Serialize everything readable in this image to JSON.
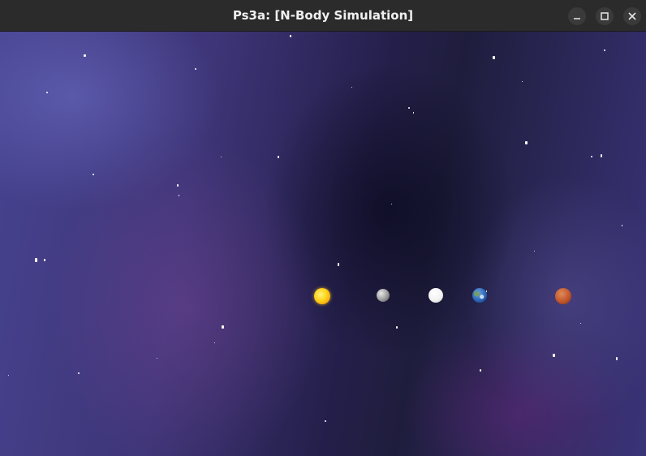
{
  "window": {
    "title": "Ps3a: [N-Body Simulation]",
    "buttons": {
      "minimize": "minimize-icon",
      "maximize": "maximize-icon",
      "close": "close-icon"
    }
  },
  "simulation": {
    "bodies": [
      {
        "name": "sun",
        "icon": "sun-icon",
        "color": "#ffd21a"
      },
      {
        "name": "mercury",
        "icon": "mercury-icon",
        "color": "#9a9a9a"
      },
      {
        "name": "venus",
        "icon": "venus-icon",
        "color": "#f2f2f2"
      },
      {
        "name": "earth",
        "icon": "earth-icon",
        "color": "#2b66b8"
      },
      {
        "name": "mars",
        "icon": "mars-icon",
        "color": "#c2562b"
      }
    ],
    "background": {
      "icon": "starfield-background",
      "accent": "#46438f"
    }
  }
}
